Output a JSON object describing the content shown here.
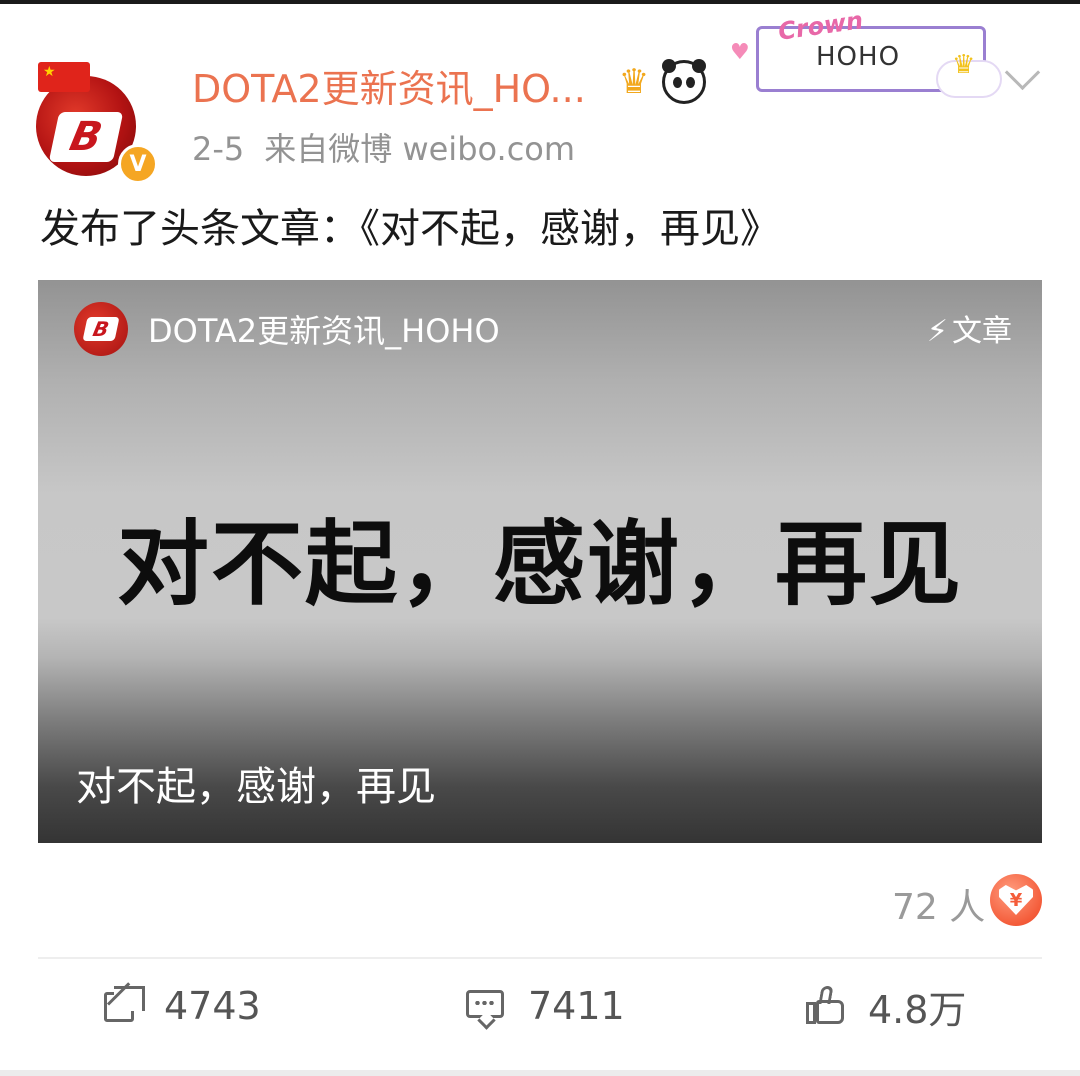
{
  "post": {
    "author": "DOTA2更新资讯_HO...",
    "date": "2-5",
    "source": "来自微博 weibo.com",
    "text": "发布了头条文章：《对不起，感谢，再见》"
  },
  "decoration": {
    "word": "Crown",
    "name": "HOHO"
  },
  "article_card": {
    "author": "DOTA2更新资讯_HOHO",
    "type_label": "文章",
    "headline": "对不起，感谢，再见",
    "caption": "对不起，感谢，再见"
  },
  "reward": {
    "count_label": "72 人",
    "icon_glyph": "¥"
  },
  "actions": {
    "share_count": "4743",
    "comment_count": "7411",
    "like_count": "4.8万"
  },
  "colors": {
    "username": "#eb7350",
    "meta": "#939393",
    "reward_accent": "#f45c3a"
  },
  "icons": {
    "verified": "verified-badge-icon",
    "crown": "crown-badge-icon",
    "panda": "panda-badge-icon",
    "menu": "chevron-down-icon",
    "share": "share-icon",
    "comment": "comment-icon",
    "like": "thumbs-up-icon",
    "reward": "reward-heart-icon"
  }
}
